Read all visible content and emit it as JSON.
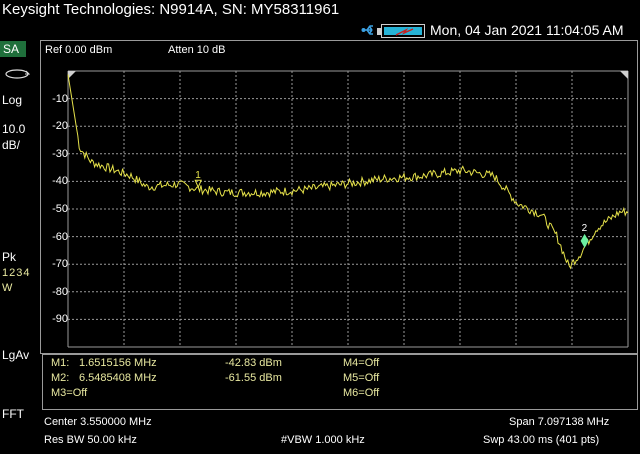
{
  "window": {
    "title": "Keysight Technologies: N9914A, SN: MY58311961"
  },
  "status": {
    "datetime": "Mon, 04 Jan 2021 11:04:05 AM",
    "icons": [
      "usb-icon",
      "battery-icon"
    ]
  },
  "left_panel": {
    "mode": "SA",
    "scale_type": "Log",
    "scale_value": "10.0",
    "scale_unit": "dB/",
    "detector": "Pk",
    "traces": "1234",
    "trace_mode": "W",
    "averaging": "LgAv",
    "sweep_type": "FFT"
  },
  "header": {
    "ref_level": "Ref 0.00 dBm",
    "attenuation": "Atten 10 dB"
  },
  "markers": {
    "m1_label": "M1:",
    "m1_freq": "1.6515156 MHz",
    "m1_amp": "-42.83 dBm",
    "m2_label": "M2:",
    "m2_freq": "6.5485408 MHz",
    "m2_amp": "-61.55 dBm",
    "m3": "M3=Off",
    "m4": "M4=Off",
    "m5": "M5=Off",
    "m6": "M6=Off",
    "plot_m1": "1",
    "plot_m2": "2"
  },
  "footer": {
    "center": "Center 3.550000 MHz",
    "span": "Span 7.097138 MHz",
    "res_bw": "Res BW 50.00 kHz",
    "vbw": "#VBW 1.000 kHz",
    "sweep": "Swp 43.00 ms (401 pts)"
  },
  "colors": {
    "trace": "#e6e24a",
    "grid": "#9a9a9a",
    "marker_active": "#6cf0a0",
    "mode_badge": "#1f6f3b",
    "battery_fill": "#27b3d6"
  },
  "chart_data": {
    "type": "line",
    "y_ticks": [
      "-10",
      "-20",
      "-30",
      "-40",
      "-50",
      "-60",
      "-70",
      "-80",
      "-90"
    ],
    "ylim": [
      -100,
      0
    ],
    "xlim_mhz": [
      0.001431,
      7.098569
    ],
    "grid": true,
    "series": [
      {
        "x": [
          0.0,
          0.15,
          0.3,
          0.5,
          0.8,
          1.0,
          1.4,
          1.65,
          2.0,
          2.5,
          3.0,
          3.5,
          4.0,
          4.5,
          5.0,
          5.4,
          5.7,
          6.0,
          6.2,
          6.35,
          6.5,
          6.7,
          7.0,
          7.1
        ],
        "y": [
          -1,
          -28,
          -33,
          -35,
          -38,
          -42,
          -41,
          -42.8,
          -44,
          -44,
          -43,
          -41,
          -39,
          -38,
          -36,
          -38,
          -48,
          -52,
          -60,
          -71,
          -66,
          -57,
          -51,
          -51
        ]
      }
    ],
    "markers": [
      {
        "id": "1",
        "x": 1.6515156,
        "y": -42.83
      },
      {
        "id": "2",
        "x": 6.5485408,
        "y": -61.55
      }
    ]
  }
}
